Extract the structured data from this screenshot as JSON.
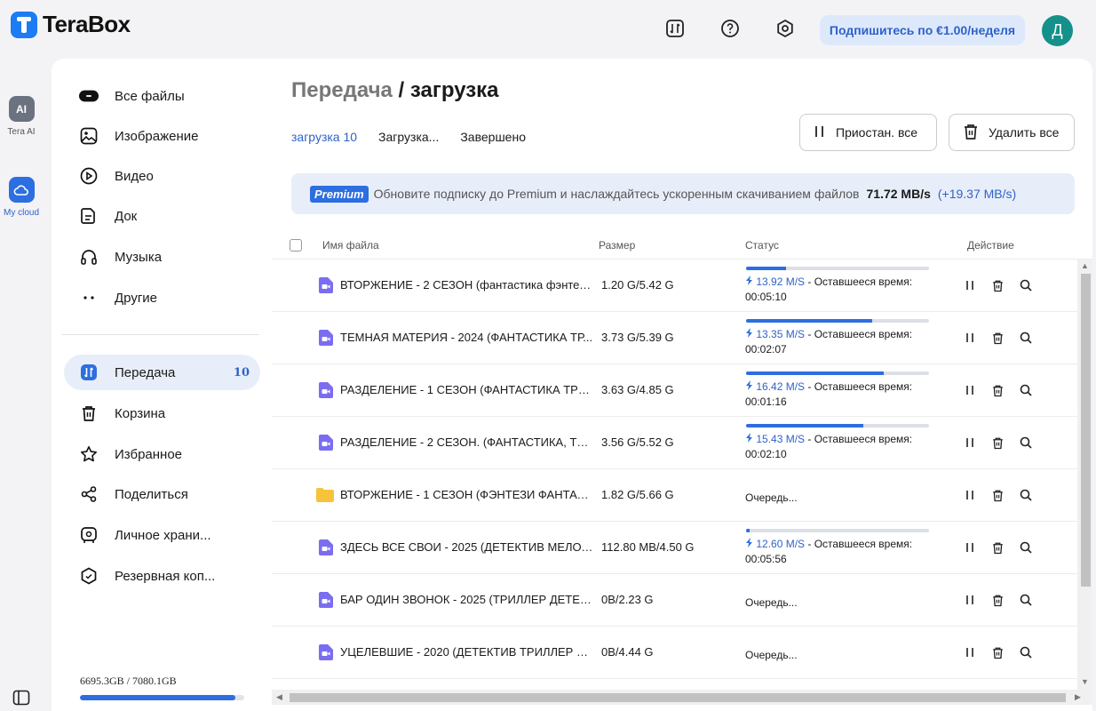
{
  "app": {
    "name": "TeraBox"
  },
  "header": {
    "subscribe_label": "Подпишитесь по €1.00/неделя",
    "avatar_letter": "Д"
  },
  "rail": {
    "ai_label": "Tera AI",
    "ai_badge": "AI",
    "cloud_label": "My cloud"
  },
  "sidebar": {
    "items": [
      {
        "label": "Все файлы",
        "icon": "all-files-icon"
      },
      {
        "label": "Изображение",
        "icon": "image-icon"
      },
      {
        "label": "Видео",
        "icon": "video-icon"
      },
      {
        "label": "Док",
        "icon": "doc-icon"
      },
      {
        "label": "Музыка",
        "icon": "music-icon"
      },
      {
        "label": "Другие",
        "icon": "other-icon"
      }
    ],
    "secondary": [
      {
        "label": "Передача",
        "icon": "transfer-icon",
        "count": "10",
        "active": true
      },
      {
        "label": "Корзина",
        "icon": "trash-icon"
      },
      {
        "label": "Избранное",
        "icon": "star-icon"
      },
      {
        "label": "Поделиться",
        "icon": "share-icon"
      },
      {
        "label": "Личное храни...",
        "icon": "vault-icon"
      },
      {
        "label": "Резервная коп...",
        "icon": "backup-icon"
      }
    ],
    "storage": {
      "text": "6695.3GB / 7080.1GB",
      "used_fraction": 0.946
    }
  },
  "main": {
    "title_part1": "Передача",
    "title_sep": "/",
    "title_part2": "загрузка",
    "tabs": [
      "загрузка 10",
      "Загрузка...",
      "Завершено"
    ],
    "pause_all_label": "Приостан. все",
    "delete_all_label": "Удалить все",
    "banner": {
      "badge": "Premium",
      "text": "Обновите подписку до Premium и наслаждайтесь ускоренным скачиванием файлов",
      "speed": "71.72 MB/s",
      "extra": "(+19.37 MB/s)"
    },
    "columns": {
      "name": "Имя файла",
      "size": "Размер",
      "status": "Статус",
      "action": "Действие"
    },
    "time_label": "- Оставшееся время:",
    "rows": [
      {
        "type": "video",
        "name": "ВТОРЖЕНИЕ - 2 СЕЗОН (фантастика фэнтези...",
        "size": "1.20 G/5.42 G",
        "status": "downloading",
        "speed": "13.92 M/S",
        "time": "00:05:10",
        "progress": 0.22
      },
      {
        "type": "video",
        "name": "ТЕМНАЯ МАТЕРИЯ - 2024 (ФАНТАСТИКА ТР...",
        "size": "3.73 G/5.39 G",
        "status": "downloading",
        "speed": "13.35 M/S",
        "time": "00:02:07",
        "progress": 0.69
      },
      {
        "type": "video",
        "name": "РАЗДЕЛЕНИЕ - 1 СЕЗОН (ФАНТАСТИКА ТРИ...",
        "size": "3.63 G/4.85 G",
        "status": "downloading",
        "speed": "16.42 M/S",
        "time": "00:01:16",
        "progress": 0.75
      },
      {
        "type": "video",
        "name": "РАЗДЕЛЕНИЕ - 2 СЕЗОН. (ФАНТАСТИКА, ТРИ...",
        "size": "3.56 G/5.52 G",
        "status": "downloading",
        "speed": "15.43 M/S",
        "time": "00:02:10",
        "progress": 0.64
      },
      {
        "type": "folder",
        "name": "ВТОРЖЕНИЕ - 1 СЕЗОН (ФЭНТЕЗИ ФАНТАСТ...",
        "size": "1.82 G/5.66 G",
        "status": "queued",
        "queue_text": "Очередь..."
      },
      {
        "type": "video",
        "name": "ЗДЕСЬ ВСЕ СВОИ - 2025 (ДЕТЕКТИВ МЕЛОД...",
        "size": "112.80 MB/4.50 G",
        "status": "downloading",
        "speed": "12.60 M/S",
        "time": "00:05:56",
        "progress": 0.02
      },
      {
        "type": "video",
        "name": "БАР ОДИН ЗВОНОК - 2025 (ТРИЛЛЕР ДЕТЕК...",
        "size": "0B/2.23 G",
        "status": "queued",
        "queue_text": "Очередь..."
      },
      {
        "type": "video",
        "name": "УЦЕЛЕВШИЕ - 2020 (ДЕТЕКТИВ ТРИЛЛЕР 8 С...",
        "size": "0B/4.44 G",
        "status": "queued",
        "queue_text": "Очередь..."
      }
    ]
  },
  "colors": {
    "accent": "#2d6ee0",
    "accent_text": "#2f62c8",
    "avatar": "#14918a"
  }
}
